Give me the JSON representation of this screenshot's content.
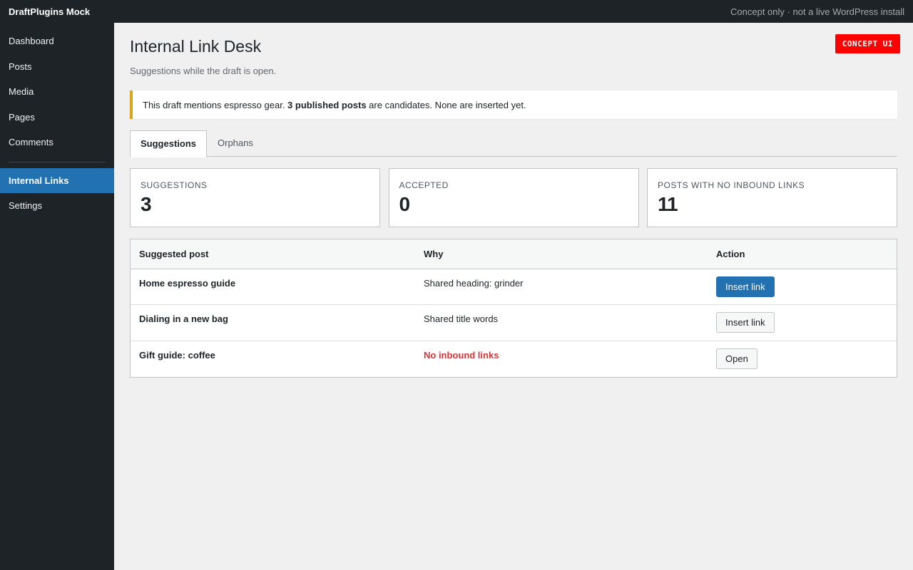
{
  "topbar": {
    "brand": "DraftPlugins Mock",
    "note": "Concept only · not a live WordPress install"
  },
  "sidebar": {
    "items": [
      {
        "label": "Dashboard"
      },
      {
        "label": "Posts"
      },
      {
        "label": "Media"
      },
      {
        "label": "Pages"
      },
      {
        "label": "Comments"
      },
      {
        "label": "Internal Links",
        "active": true
      },
      {
        "label": "Settings"
      }
    ]
  },
  "page": {
    "title": "Internal Link Desk",
    "subtitle": "Suggestions while the draft is open.",
    "badge": "CONCEPT UI"
  },
  "notice": {
    "before": "This draft mentions espresso gear. ",
    "bold": "3 published posts",
    "after": " are candidates. None are inserted yet."
  },
  "tabs": [
    {
      "label": "Suggestions",
      "active": true
    },
    {
      "label": "Orphans",
      "active": false
    }
  ],
  "stats": [
    {
      "label": "Suggestions",
      "value": "3"
    },
    {
      "label": "Accepted",
      "value": "0"
    },
    {
      "label": "Posts with no inbound links",
      "value": "11"
    }
  ],
  "table": {
    "headers": {
      "post": "Suggested post",
      "why": "Why",
      "action": "Action"
    },
    "rows": [
      {
        "post": "Home espresso guide",
        "why": "Shared heading: grinder",
        "action": "Insert link",
        "action_style": "primary"
      },
      {
        "post": "Dialing in a new bag",
        "why": "Shared title words",
        "action": "Insert link",
        "action_style": "secondary"
      },
      {
        "post": "Gift guide: coffee",
        "why": "No inbound links",
        "why_style": "warning",
        "action": "Open",
        "action_style": "secondary"
      }
    ]
  },
  "colors": {
    "admin_bar": "#1d2327",
    "accent": "#2271b1",
    "notice_border": "#dba617",
    "badge": "#ff0000",
    "warning_text": "#d63638"
  }
}
